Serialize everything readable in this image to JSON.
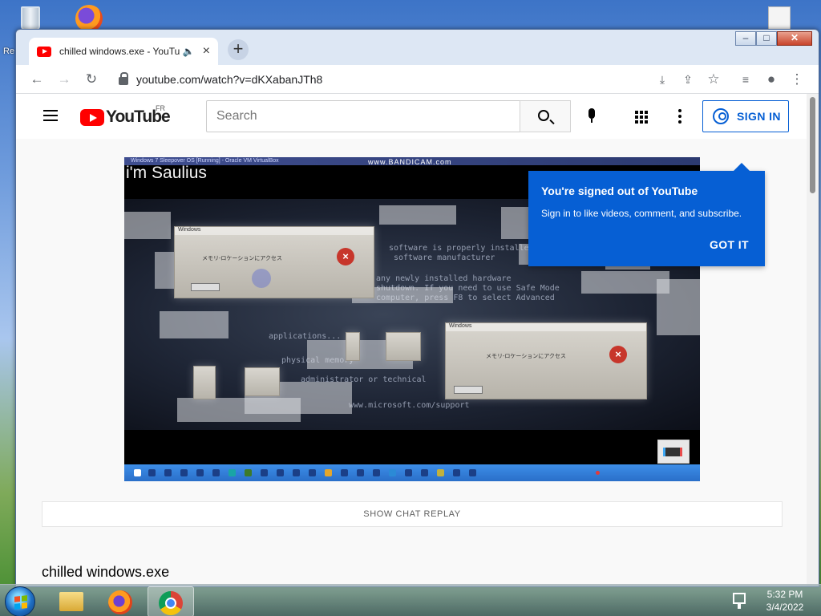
{
  "desktop": {
    "icons": [
      {
        "name": "recycle-bin",
        "label": "Re"
      },
      {
        "name": "firefox"
      },
      {
        "name": "document"
      }
    ]
  },
  "browser": {
    "tab": {
      "title": "chilled windows.exe - YouTube",
      "audio_icon": "speaker-icon",
      "close": "×"
    },
    "new_tab": "+",
    "window_controls": {
      "minimize": "–",
      "maximize": "□",
      "close": "✕"
    },
    "nav": {
      "back": "←",
      "forward": "→",
      "reload": "↻"
    },
    "url": "youtube.com/watch?v=dKXabanJTh8",
    "toolbar_icons": [
      "download-icon",
      "share-icon",
      "star-icon",
      "media-icon",
      "profile-icon",
      "menu-icon"
    ]
  },
  "youtube": {
    "logo_text": "YouTube",
    "country_code": "FR",
    "search_placeholder": "Search",
    "sign_in_label": "SIGN IN",
    "tooltip": {
      "title": "You're signed out of YouTube",
      "body": "Sign in to like videos, comment, and subscribe.",
      "button": "GOT IT"
    },
    "video": {
      "window_title": "Windows 7 Sleepover OS [Running] - Oracle VM VirtualBox",
      "watermark": "www.BANDICAM.com",
      "overlay_caption": "i'm Saulius",
      "error_caption": "Windows",
      "error_message": "メモリ-ロケーションにアクセス",
      "bsod_lines": [
        "software is properly installed",
        "software manufacturer",
        "any newly installed hardware",
        "shutdown. If you need to use Safe Mode",
        "computer, press F8 to select Advanced",
        "applications...",
        "physical memory",
        "administrator or technical",
        "www.microsoft.com/support"
      ]
    },
    "show_chat_replay": "SHOW CHAT REPLAY",
    "video_title": "chilled windows.exe"
  },
  "taskbar": {
    "apps": [
      "file-explorer",
      "firefox",
      "chrome"
    ],
    "time": "5:32 PM",
    "date": "3/4/2022"
  },
  "colors": {
    "yt_red": "#ff0000",
    "yt_blue": "#065fd4",
    "taskbar": "#5b7380"
  }
}
